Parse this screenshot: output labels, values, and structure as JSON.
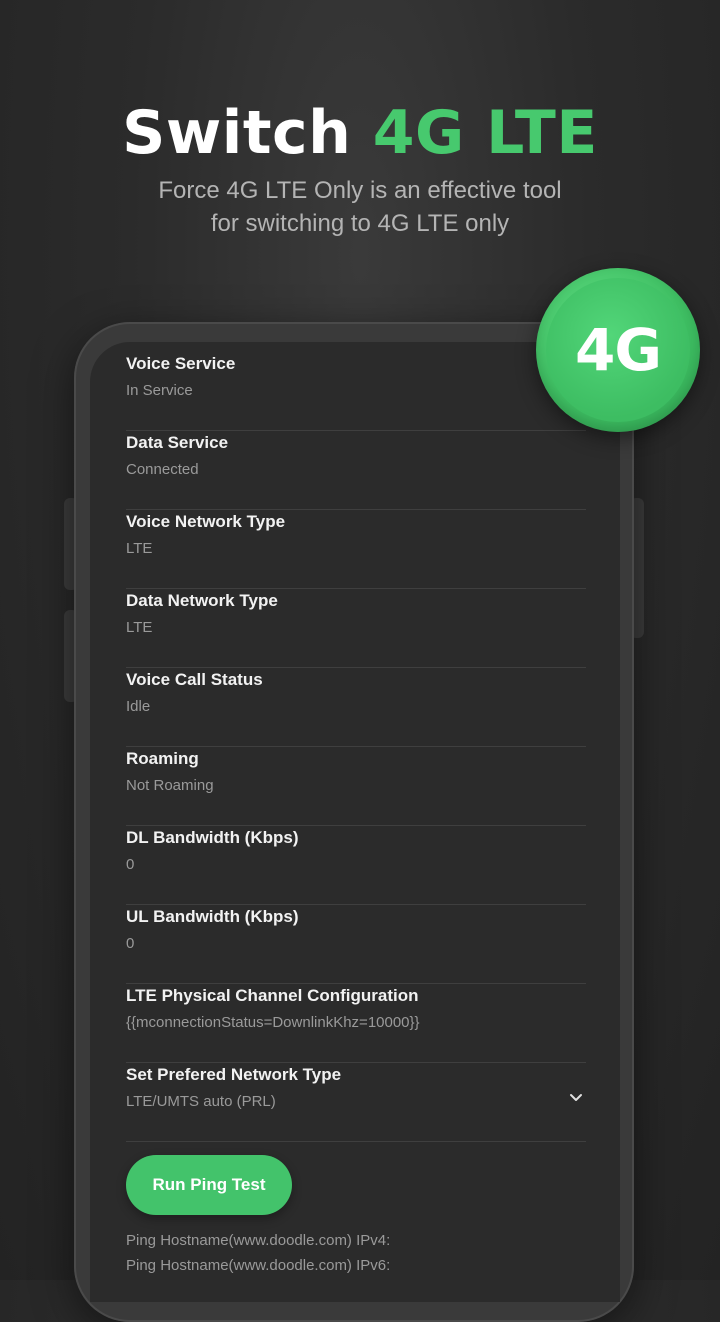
{
  "promo": {
    "title_main": "Switch ",
    "title_accent": "4G LTE",
    "subtitle_line1": "Force 4G LTE Only is an effective tool",
    "subtitle_line2": "for switching to 4G LTE only"
  },
  "badge": {
    "label": "4G"
  },
  "info_rows": [
    {
      "label": "Voice Service",
      "value": "In Service"
    },
    {
      "label": "Data Service",
      "value": "Connected"
    },
    {
      "label": "Voice Network Type",
      "value": "LTE"
    },
    {
      "label": "Data Network Type",
      "value": "LTE"
    },
    {
      "label": "Voice Call Status",
      "value": "Idle"
    },
    {
      "label": "Roaming",
      "value": "Not Roaming"
    },
    {
      "label": "DL Bandwidth (Kbps)",
      "value": "0"
    },
    {
      "label": "UL Bandwidth (Kbps)",
      "value": "0"
    },
    {
      "label": "LTE Physical Channel Configuration",
      "value": "{{mconnectionStatus=DownlinkKhz=10000}}"
    },
    {
      "label": "Set Prefered Network Type",
      "value": "LTE/UMTS auto (PRL)"
    }
  ],
  "ping": {
    "button_label": "Run Ping Test",
    "ipv4_line": "Ping Hostname(www.doodle.com) IPv4:",
    "ipv6_line": "Ping Hostname(www.doodle.com) IPv6:"
  },
  "colors": {
    "accent": "#47c96e",
    "background": "#2b2b2b"
  },
  "icons": {
    "dropdown": "chevron-down-icon"
  }
}
